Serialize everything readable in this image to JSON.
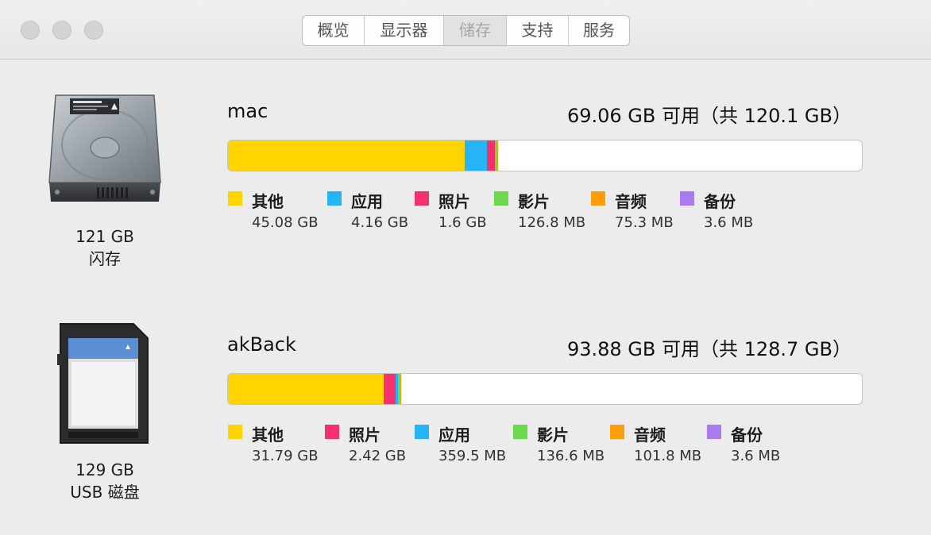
{
  "tabs": [
    "概览",
    "显示器",
    "储存",
    "支持",
    "服务"
  ],
  "active_tab": "储存",
  "colors": {
    "other": "#ffd400",
    "apps": "#25b4f5",
    "photos": "#f5306e",
    "movies": "#6dd84c",
    "audio": "#ff9e0a",
    "backups": "#a87cf0"
  },
  "devices": [
    {
      "icon": "hard-drive-icon",
      "size": "121 GB",
      "type": "闪存",
      "volume_name": "mac",
      "free_text": "69.06 GB 可用（共 120.1 GB）",
      "legend": [
        {
          "label": "其他",
          "value": "45.08 GB",
          "color": "#ffd400"
        },
        {
          "label": "应用",
          "value": "4.16 GB",
          "color": "#25b4f5"
        },
        {
          "label": "照片",
          "value": "1.6 GB",
          "color": "#f5306e"
        },
        {
          "label": "影片",
          "value": "126.8 MB",
          "color": "#6dd84c"
        },
        {
          "label": "音频",
          "value": "75.3 MB",
          "color": "#ff9e0a"
        },
        {
          "label": "备份",
          "value": "3.6 MB",
          "color": "#a87cf0"
        }
      ]
    },
    {
      "icon": "sd-card-icon",
      "size": "129 GB",
      "type": "USB 磁盘",
      "volume_name": "akBack",
      "free_text": "93.88 GB 可用（共 128.7 GB）",
      "legend": [
        {
          "label": "其他",
          "value": "31.79 GB",
          "color": "#ffd400"
        },
        {
          "label": "照片",
          "value": "2.42 GB",
          "color": "#f5306e"
        },
        {
          "label": "应用",
          "value": "359.5 MB",
          "color": "#25b4f5"
        },
        {
          "label": "影片",
          "value": "136.6 MB",
          "color": "#6dd84c"
        },
        {
          "label": "音频",
          "value": "101.8 MB",
          "color": "#ff9e0a"
        },
        {
          "label": "备份",
          "value": "3.6 MB",
          "color": "#a87cf0"
        }
      ]
    }
  ]
}
